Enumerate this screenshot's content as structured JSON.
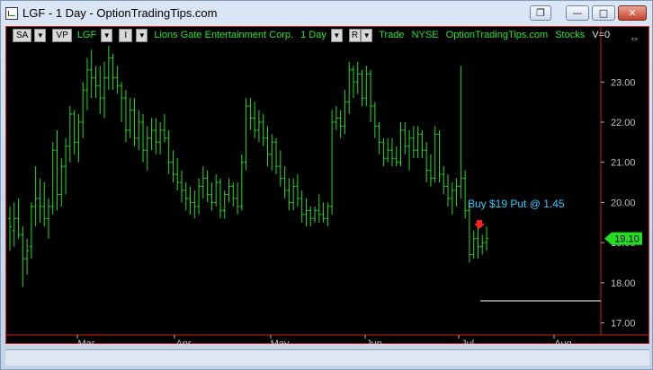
{
  "window": {
    "title": "LGF - 1 Day - OptionTradingTips.com",
    "buttons": [
      "restore",
      "minimize",
      "maximize",
      "close"
    ]
  },
  "toolbar": {
    "sa_label": "SA",
    "vp_label": "VP",
    "symbol": "LGF",
    "i_label": "I",
    "company": "Lions Gate Entertainment Corp.",
    "interval": "1 Day",
    "r_label": "R",
    "trade": "Trade",
    "exchange": "NYSE",
    "source": "OptionTradingTips.com",
    "category": "Stocks",
    "volume": "V=0"
  },
  "annotation": {
    "text": "Buy $19 Put @ 1.45",
    "color": "#33ccff",
    "arrow_color": "#ff2020"
  },
  "price_tag": {
    "value": "19.10",
    "color": "#22dd22"
  },
  "colors": {
    "background": "#000000",
    "bars": "#22dd22",
    "axis": "#b0b0b0",
    "border": "#d02020",
    "text_labels": "#c0c0c0"
  },
  "chart_data": {
    "type": "bar",
    "y_axis": {
      "ticks": [
        "17.00",
        "18.00",
        "19.00",
        "20.00",
        "21.00",
        "22.00",
        "23.00"
      ],
      "range": [
        16.7,
        23.9
      ]
    },
    "x_axis": {
      "ticks": [
        "Mar",
        "Apr",
        "May",
        "Jun",
        "Jul",
        "Aug"
      ]
    },
    "reference_line": {
      "value": 17.55
    },
    "ohlc": [
      [
        19.6,
        19.9,
        18.8,
        19.4
      ],
      [
        19.3,
        20.0,
        18.9,
        19.6
      ],
      [
        19.6,
        20.1,
        19.1,
        19.2
      ],
      [
        19.2,
        19.4,
        17.9,
        18.6
      ],
      [
        18.6,
        19.1,
        18.2,
        18.8
      ],
      [
        18.9,
        20.0,
        18.6,
        19.9
      ],
      [
        19.9,
        20.9,
        19.4,
        20.1
      ],
      [
        20.1,
        20.6,
        19.5,
        19.9
      ],
      [
        19.9,
        20.5,
        19.4,
        19.6
      ],
      [
        19.6,
        20.1,
        19.1,
        19.9
      ],
      [
        19.9,
        21.5,
        19.7,
        21.3
      ],
      [
        21.3,
        21.8,
        19.8,
        20.2
      ],
      [
        20.2,
        21.1,
        19.9,
        20.9
      ],
      [
        20.9,
        21.6,
        20.2,
        21.4
      ],
      [
        21.4,
        22.4,
        21.0,
        22.2
      ],
      [
        22.2,
        22.3,
        21.2,
        21.5
      ],
      [
        21.5,
        22.2,
        21.0,
        22.0
      ],
      [
        22.0,
        23.0,
        21.6,
        22.8
      ],
      [
        22.8,
        23.6,
        22.3,
        23.3
      ],
      [
        23.3,
        23.8,
        22.6,
        23.1
      ],
      [
        23.1,
        23.4,
        22.6,
        22.9
      ],
      [
        22.9,
        23.4,
        22.2,
        22.6
      ],
      [
        22.6,
        23.5,
        22.1,
        23.1
      ],
      [
        23.1,
        23.9,
        22.8,
        23.6
      ],
      [
        23.6,
        23.7,
        22.8,
        23.1
      ],
      [
        23.1,
        23.4,
        22.7,
        22.9
      ],
      [
        22.9,
        23.0,
        22.0,
        22.6
      ],
      [
        22.6,
        22.8,
        21.5,
        21.8
      ],
      [
        21.8,
        22.6,
        21.6,
        22.3
      ],
      [
        22.3,
        22.6,
        21.4,
        21.6
      ],
      [
        21.6,
        22.3,
        21.3,
        22.0
      ],
      [
        22.0,
        22.2,
        21.0,
        21.3
      ],
      [
        21.3,
        21.9,
        20.8,
        21.6
      ],
      [
        21.6,
        22.1,
        21.3,
        21.8
      ],
      [
        21.8,
        22.1,
        21.2,
        21.5
      ],
      [
        21.5,
        22.0,
        21.2,
        21.8
      ],
      [
        21.8,
        22.2,
        21.5,
        21.6
      ],
      [
        21.6,
        21.8,
        20.7,
        21.0
      ],
      [
        21.0,
        21.3,
        20.5,
        20.7
      ],
      [
        20.7,
        21.1,
        20.3,
        20.5
      ],
      [
        20.5,
        20.8,
        20.0,
        20.3
      ],
      [
        20.3,
        20.5,
        19.8,
        20.1
      ],
      [
        20.1,
        20.4,
        19.7,
        20.0
      ],
      [
        20.0,
        20.3,
        19.6,
        19.9
      ],
      [
        19.9,
        20.6,
        19.7,
        20.4
      ],
      [
        20.4,
        20.9,
        20.1,
        20.6
      ],
      [
        20.6,
        20.8,
        20.0,
        20.2
      ],
      [
        20.2,
        20.5,
        19.8,
        20.0
      ],
      [
        20.0,
        20.7,
        19.9,
        20.5
      ],
      [
        20.5,
        20.6,
        19.6,
        19.8
      ],
      [
        19.8,
        20.3,
        19.6,
        20.2
      ],
      [
        20.2,
        20.6,
        20.0,
        20.4
      ],
      [
        20.4,
        20.5,
        19.9,
        20.1
      ],
      [
        20.1,
        20.5,
        19.7,
        19.9
      ],
      [
        19.9,
        21.2,
        19.8,
        21.0
      ],
      [
        21.0,
        22.6,
        20.8,
        22.4
      ],
      [
        22.4,
        22.6,
        21.8,
        22.1
      ],
      [
        22.1,
        22.5,
        21.6,
        21.8
      ],
      [
        21.8,
        22.3,
        21.5,
        22.0
      ],
      [
        22.0,
        22.2,
        21.4,
        21.6
      ],
      [
        21.6,
        21.9,
        20.9,
        21.2
      ],
      [
        21.2,
        21.7,
        20.8,
        21.5
      ],
      [
        21.5,
        21.6,
        20.7,
        20.9
      ],
      [
        20.9,
        21.3,
        20.4,
        20.6
      ],
      [
        20.6,
        20.9,
        20.1,
        20.3
      ],
      [
        20.3,
        20.6,
        19.8,
        20.0
      ],
      [
        20.0,
        20.6,
        19.8,
        20.4
      ],
      [
        20.4,
        20.7,
        19.9,
        20.1
      ],
      [
        20.1,
        20.3,
        19.5,
        19.7
      ],
      [
        19.7,
        20.1,
        19.4,
        19.8
      ],
      [
        19.8,
        19.9,
        19.4,
        19.6
      ],
      [
        19.6,
        19.9,
        19.5,
        19.8
      ],
      [
        19.8,
        20.2,
        19.5,
        19.7
      ],
      [
        19.7,
        20.0,
        19.5,
        19.6
      ],
      [
        19.6,
        20.0,
        19.4,
        19.9
      ],
      [
        19.9,
        22.3,
        19.7,
        22.0
      ],
      [
        22.0,
        22.4,
        21.8,
        22.1
      ],
      [
        22.1,
        22.3,
        21.6,
        21.9
      ],
      [
        21.9,
        22.8,
        21.7,
        22.5
      ],
      [
        22.5,
        23.5,
        22.2,
        23.3
      ],
      [
        23.3,
        23.4,
        22.6,
        23.0
      ],
      [
        23.0,
        23.5,
        22.7,
        23.2
      ],
      [
        23.2,
        23.3,
        22.4,
        22.6
      ],
      [
        22.6,
        23.4,
        22.4,
        23.2
      ],
      [
        23.2,
        23.3,
        22.0,
        22.4
      ],
      [
        22.4,
        22.5,
        21.6,
        21.9
      ],
      [
        21.9,
        22.0,
        21.2,
        21.5
      ],
      [
        21.5,
        21.6,
        20.9,
        21.1
      ],
      [
        21.1,
        21.6,
        21.0,
        21.3
      ],
      [
        21.3,
        21.6,
        20.9,
        21.1
      ],
      [
        21.1,
        21.4,
        20.9,
        21.0
      ],
      [
        21.0,
        22.0,
        20.9,
        21.8
      ],
      [
        21.8,
        22.0,
        21.2,
        21.4
      ],
      [
        21.4,
        21.8,
        20.8,
        21.6
      ],
      [
        21.6,
        21.9,
        21.1,
        21.3
      ],
      [
        21.3,
        21.9,
        21.1,
        21.7
      ],
      [
        21.7,
        21.8,
        21.1,
        21.3
      ],
      [
        21.3,
        21.5,
        20.5,
        20.8
      ],
      [
        20.8,
        21.2,
        20.4,
        20.6
      ],
      [
        20.6,
        21.9,
        20.5,
        21.7
      ],
      [
        21.7,
        21.8,
        20.5,
        20.7
      ],
      [
        20.7,
        20.9,
        20.2,
        20.4
      ],
      [
        20.4,
        20.7,
        19.9,
        20.1
      ],
      [
        20.1,
        20.5,
        19.7,
        20.3
      ],
      [
        20.3,
        20.6,
        19.9,
        20.4
      ],
      [
        20.4,
        23.4,
        20.1,
        20.6
      ],
      [
        20.6,
        20.8,
        19.6,
        19.8
      ],
      [
        19.8,
        20.0,
        18.5,
        18.7
      ],
      [
        18.7,
        19.3,
        18.6,
        19.1
      ],
      [
        19.1,
        19.4,
        18.6,
        18.9
      ],
      [
        18.9,
        19.2,
        18.7,
        19.0
      ],
      [
        19.0,
        19.4,
        18.8,
        19.1
      ]
    ]
  }
}
